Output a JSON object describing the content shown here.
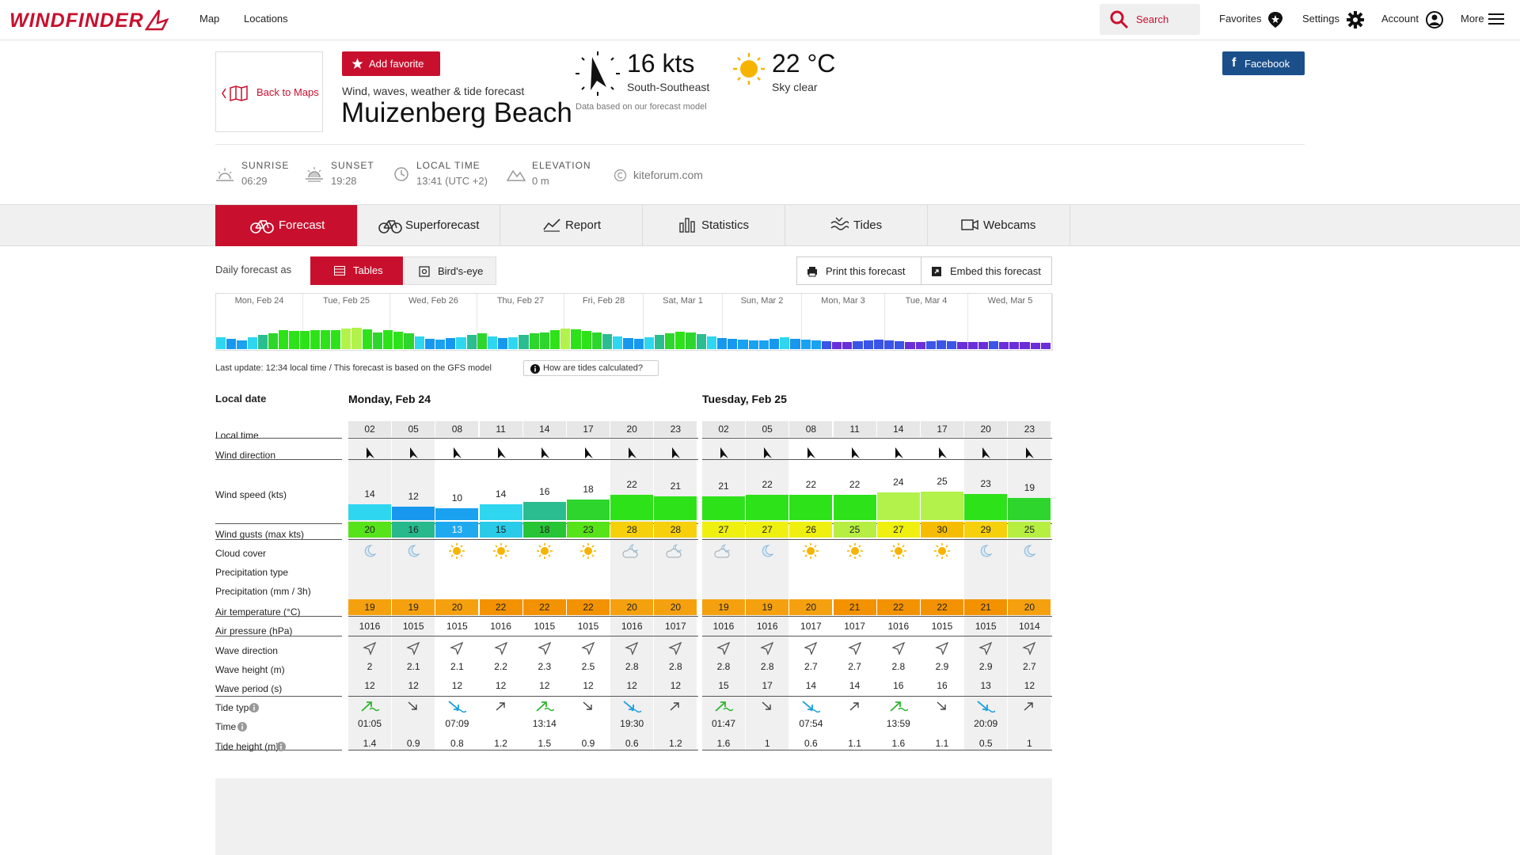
{
  "nav": {
    "logo": "WINDFINDER",
    "links": [
      "Map",
      "Locations"
    ],
    "search": "Search",
    "favorites": "Favorites",
    "settings": "Settings",
    "account": "Account",
    "more": "More"
  },
  "header": {
    "back": "Back to Maps",
    "add_favorite": "Add favorite",
    "subtitle": "Wind, waves, weather & tide forecast",
    "title": "Muizenberg Beach",
    "wind_speed": "16 kts",
    "wind_direction": "South-Southeast",
    "temperature": "22 °C",
    "sky": "Sky clear",
    "model_note": "Data based on our forecast model",
    "facebook": "Facebook"
  },
  "info": {
    "sunrise_label": "SUNRISE",
    "sunrise": "06:29",
    "sunset_label": "SUNSET",
    "sunset": "19:28",
    "localtime_label": "LOCAL TIME",
    "localtime": "13:41 (UTC +2)",
    "elevation_label": "ELEVATION",
    "elevation": "0 m",
    "credit": "kiteforum.com"
  },
  "tabs": [
    "Forecast",
    "Superforecast",
    "Report",
    "Statistics",
    "Tides",
    "Webcams"
  ],
  "controls": {
    "daily_label": "Daily forecast as",
    "tables": "Tables",
    "birdseye": "Bird's-eye",
    "print": "Print this forecast",
    "embed": "Embed this forecast"
  },
  "strip_days": [
    "Mon, Feb 24",
    "Tue, Feb 25",
    "Wed, Feb 26",
    "Thu, Feb 27",
    "Fri, Feb 28",
    "Sat, Mar 1",
    "Sun, Mar 2",
    "Mon, Mar 3",
    "Tue, Mar 4",
    "Wed, Mar 5"
  ],
  "last_update": "Last update: 12:34 local time / This forecast is based on the GFS model",
  "how_tides": "How are tides calculated?",
  "table": {
    "local_date": "Local date",
    "row_labels": [
      "Local time",
      "Wind direction",
      "Wind speed (kts)",
      "Wind gusts (max kts)",
      "Cloud cover",
      "Precipitation type",
      "Precipitation (mm / 3h)",
      "Air temperature (°C)",
      "Air pressure (hPa)",
      "Wave direction",
      "Wave height (m)",
      "Wave period (s)",
      "Tide type",
      "Time",
      "Tide height (m)"
    ],
    "days": [
      {
        "name": "Monday, Feb 24",
        "times": [
          "02",
          "05",
          "08",
          "11",
          "14",
          "17",
          "20",
          "23"
        ],
        "wind_speed": [
          14,
          12,
          10,
          14,
          16,
          18,
          22,
          21
        ],
        "gusts": [
          20,
          16,
          13,
          15,
          18,
          23,
          28,
          28
        ],
        "clouds": [
          "moon",
          "moon",
          "sun",
          "sun",
          "sun",
          "sun",
          "cloud-night",
          "cloud-night"
        ],
        "air_temp": [
          19,
          19,
          20,
          22,
          22,
          22,
          20,
          20
        ],
        "pressure": [
          1016,
          1015,
          1015,
          1016,
          1015,
          1015,
          1016,
          1017
        ],
        "wave_height": [
          "2",
          "2.1",
          "2.1",
          "2.2",
          "2.3",
          "2.5",
          "2.8",
          "2.8"
        ],
        "wave_period": [
          12,
          12,
          12,
          12,
          12,
          12,
          12,
          12
        ],
        "tide_type": [
          "high",
          "falling",
          "low",
          "rising",
          "high",
          "falling",
          "low",
          "rising"
        ],
        "tide_time": [
          "01:05",
          "",
          "07:09",
          "",
          "13:14",
          "",
          "19:30",
          ""
        ],
        "tide_height": [
          "1.4",
          "0.9",
          "0.8",
          "1.2",
          "1.5",
          "0.9",
          "0.6",
          "1.2"
        ]
      },
      {
        "name": "Tuesday, Feb 25",
        "times": [
          "02",
          "05",
          "08",
          "11",
          "14",
          "17",
          "20",
          "23"
        ],
        "wind_speed": [
          21,
          22,
          22,
          22,
          24,
          25,
          23,
          19
        ],
        "gusts": [
          27,
          27,
          26,
          25,
          27,
          30,
          29,
          25
        ],
        "clouds": [
          "cloud-night",
          "moon",
          "sun",
          "sun",
          "sun",
          "sun",
          "moon",
          "moon"
        ],
        "air_temp": [
          19,
          19,
          20,
          21,
          22,
          22,
          21,
          20
        ],
        "pressure": [
          1016,
          1016,
          1017,
          1017,
          1016,
          1015,
          1015,
          1014
        ],
        "wave_height": [
          "2.8",
          "2.8",
          "2.7",
          "2.7",
          "2.8",
          "2.9",
          "2.9",
          "2.7"
        ],
        "wave_period": [
          15,
          17,
          14,
          14,
          16,
          16,
          13,
          12
        ],
        "tide_type": [
          "high",
          "falling",
          "low",
          "rising",
          "high",
          "falling",
          "low",
          "rising"
        ],
        "tide_time": [
          "01:47",
          "",
          "07:54",
          "",
          "13:59",
          "",
          "20:09",
          ""
        ],
        "tide_height": [
          "1.6",
          "1",
          "0.6",
          "1.1",
          "1.6",
          "1.1",
          "0.5",
          "1"
        ]
      }
    ]
  },
  "colors": {
    "brand": "#c8102e",
    "facebook": "#1b4f8a",
    "temp_orange": "#f39200"
  }
}
